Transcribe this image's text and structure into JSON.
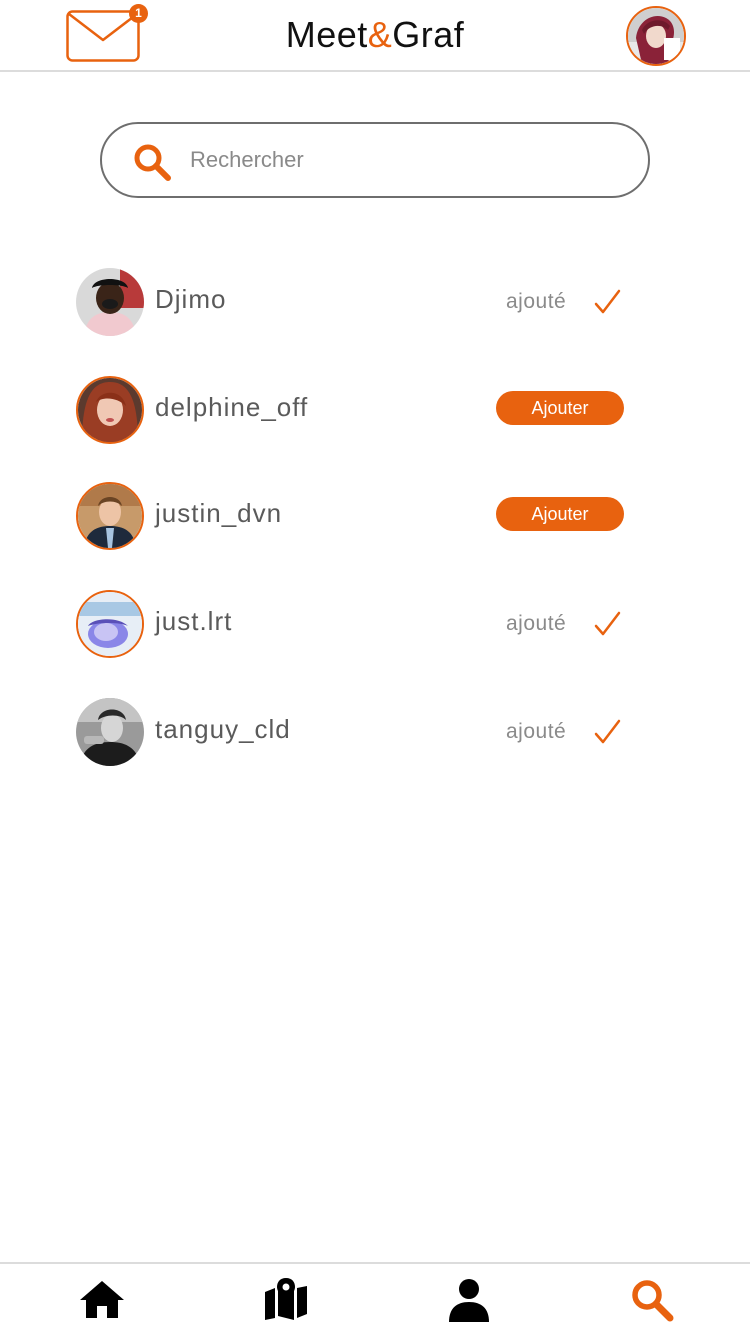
{
  "header": {
    "brand_left": "Meet",
    "brand_amp": "&",
    "brand_right": "Graf",
    "mail_badge": "1",
    "mail_icon": "envelope-icon",
    "avatar": "profile-avatar"
  },
  "search": {
    "placeholder": "Rechercher",
    "value": "",
    "icon": "search-icon"
  },
  "users": [
    {
      "name": "Djimo",
      "status": "added",
      "added_label": "ajouté"
    },
    {
      "name": "delphine_off",
      "status": "not_added",
      "button_label": "Ajouter"
    },
    {
      "name": "justin_dvn",
      "status": "not_added",
      "button_label": "Ajouter"
    },
    {
      "name": "just.lrt",
      "status": "added",
      "added_label": "ajouté"
    },
    {
      "name": "tanguy_cld",
      "status": "added",
      "added_label": "ajouté"
    }
  ],
  "bottom_nav": [
    {
      "icon": "home-icon",
      "active": false
    },
    {
      "icon": "map-icon",
      "active": false
    },
    {
      "icon": "user-icon",
      "active": false
    },
    {
      "icon": "search-icon",
      "active": true
    }
  ],
  "colors": {
    "accent": "#e8620f",
    "text": "#5a5a5a",
    "muted": "#8a8a8a",
    "divider": "#dcdcdc"
  }
}
